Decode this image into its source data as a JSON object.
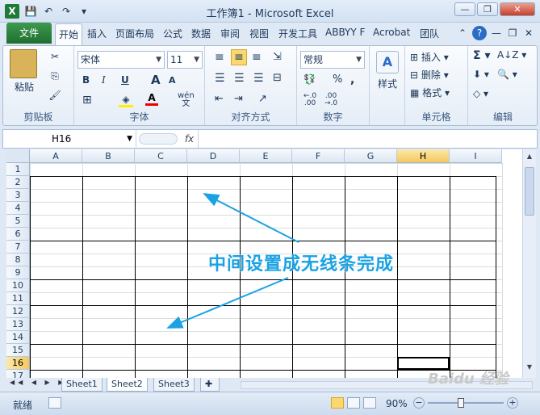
{
  "window": {
    "title": "工作簿1 - Microsoft Excel",
    "app_letter": "X"
  },
  "qat": {
    "save": "💾",
    "undo": "↶",
    "redo": "↷",
    "customize": "▾"
  },
  "window_buttons": {
    "minimize": "—",
    "restore": "❐",
    "close": "✕"
  },
  "ribbon_tabs": {
    "file": "文件",
    "items": [
      "开始",
      "插入",
      "页面布局",
      "公式",
      "数据",
      "审阅",
      "视图",
      "开发工具",
      "ABBYY F",
      "Acrobat",
      "团队"
    ],
    "active": "开始"
  },
  "clipboard": {
    "label": "剪贴板",
    "paste": "粘贴"
  },
  "font": {
    "label": "字体",
    "name": "宋体",
    "size": "11",
    "bold": "B",
    "italic": "I",
    "underline": "U",
    "grow": "A",
    "shrink": "A",
    "wen": "wén\n文"
  },
  "align": {
    "label": "对齐方式"
  },
  "number": {
    "label": "数字",
    "format": "常规"
  },
  "styles": {
    "label": "样式"
  },
  "cells": {
    "label": "单元格",
    "insert": "插入",
    "delete": "删除",
    "format": "格式"
  },
  "edit": {
    "label": "编辑"
  },
  "formula_bar": {
    "cell_ref": "H16",
    "fx": "fx",
    "value": ""
  },
  "columns": [
    "A",
    "B",
    "C",
    "D",
    "E",
    "F",
    "G",
    "H",
    "I"
  ],
  "selected_col": "H",
  "rows": [
    "1",
    "2",
    "3",
    "4",
    "5",
    "6",
    "7",
    "8",
    "9",
    "10",
    "11",
    "12",
    "13",
    "14",
    "15",
    "16",
    "17"
  ],
  "selected_row": "16",
  "sheets": [
    "Sheet1",
    "Sheet2",
    "Sheet3"
  ],
  "active_sheet": "Sheet2",
  "status": {
    "ready": "就绪",
    "zoom": "90%"
  },
  "annotation": "中间设置成无线条完成",
  "watermark": "Baidu 经验",
  "colors": {
    "annotation": "#1aa2e3",
    "file_tab": "#1e6e2f",
    "selection": "#f5c85e"
  }
}
